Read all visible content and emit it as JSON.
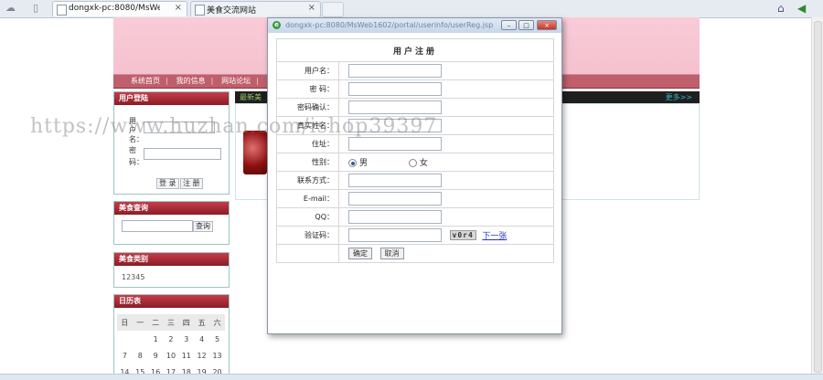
{
  "browser": {
    "tabs": [
      {
        "title": "dongxk-pc:8080/MsWeb160",
        "active": true
      },
      {
        "title": "美食交流网站",
        "active": false
      }
    ],
    "close_glyph": "×"
  },
  "site": {
    "nav_items": [
      "系统首页",
      "我的信息",
      "网站论坛",
      "公"
    ],
    "nav_sep": "|",
    "login_panel": {
      "title": "用户登陆",
      "username_label": "用户名：",
      "password_label": "密码：",
      "login_btn": "登 录",
      "register_btn": "注 册"
    },
    "search_panel": {
      "title": "美食查询",
      "search_btn": "查询"
    },
    "category_panel": {
      "title": "美食类别",
      "items": "12345"
    },
    "calendar_panel": {
      "title": "日历表",
      "weekdays": [
        "日",
        "一",
        "二",
        "三",
        "四",
        "五",
        "六"
      ],
      "rows": [
        [
          "",
          "",
          "1",
          "2",
          "3",
          "4",
          "5",
          "6"
        ],
        [
          "7",
          "8",
          "9",
          "10",
          "11",
          "12",
          "13"
        ],
        [
          "14",
          "15",
          "16",
          "17",
          "18",
          "19",
          "20"
        ]
      ]
    },
    "middle": {
      "title": "最新美",
      "more": "更多>>"
    }
  },
  "dialog": {
    "url": "dongxk-pc:8080/MsWeb1602/portal/userinfo/userReg.jsp",
    "window_buttons": {
      "min": "–",
      "max": "□",
      "close": "×"
    },
    "form_title": "用户注册",
    "labels": {
      "username": "用户名：",
      "password": "密 码：",
      "confirm": "密码确认：",
      "realname": "真实姓名：",
      "address": "住址：",
      "gender": "性别：",
      "phone": "联系方式：",
      "email": "E-mail：",
      "qq": "QQ：",
      "captcha": "验证码："
    },
    "gender_options": {
      "male": "男",
      "female": "女"
    },
    "gender_selected": "男",
    "captcha_text": "v0r4",
    "next_link": "下一张",
    "ok_btn": "确定",
    "cancel_btn": "取消"
  },
  "watermark": "https://www.huzhan.com/ishop39397"
}
